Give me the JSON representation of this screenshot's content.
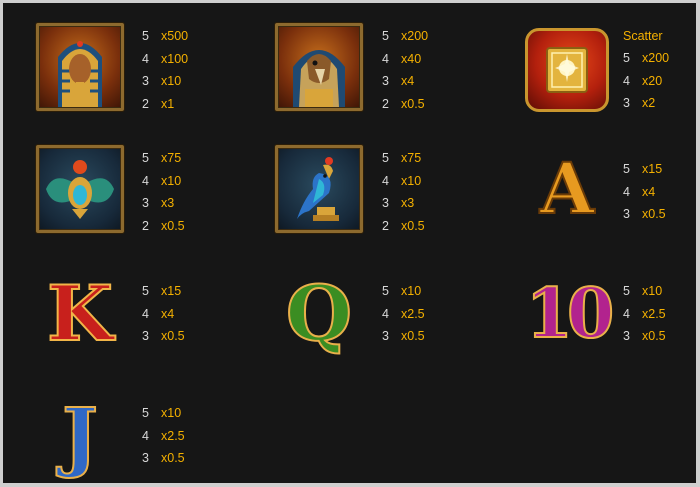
{
  "accent_color": "#f5b100",
  "count_color": "#d8d8d8",
  "symbols": [
    {
      "name": "pharaoh",
      "icon": "pharaoh-icon",
      "caption": "",
      "pays": [
        {
          "count": "5",
          "mult": "x500"
        },
        {
          "count": "4",
          "mult": "x100"
        },
        {
          "count": "3",
          "mult": "x10"
        },
        {
          "count": "2",
          "mult": "x1"
        }
      ]
    },
    {
      "name": "falcon-god",
      "icon": "horus-icon",
      "caption": "",
      "pays": [
        {
          "count": "5",
          "mult": "x200"
        },
        {
          "count": "4",
          "mult": "x40"
        },
        {
          "count": "3",
          "mult": "x4"
        },
        {
          "count": "2",
          "mult": "x0.5"
        }
      ]
    },
    {
      "name": "book",
      "icon": "book-scatter-icon",
      "caption": "Scatter",
      "pays": [
        {
          "count": "5",
          "mult": "x200"
        },
        {
          "count": "4",
          "mult": "x20"
        },
        {
          "count": "3",
          "mult": "x2"
        }
      ]
    },
    {
      "name": "scarab",
      "icon": "scarab-icon",
      "caption": "",
      "pays": [
        {
          "count": "5",
          "mult": "x75"
        },
        {
          "count": "4",
          "mult": "x10"
        },
        {
          "count": "3",
          "mult": "x3"
        },
        {
          "count": "2",
          "mult": "x0.5"
        }
      ]
    },
    {
      "name": "bird",
      "icon": "bird-statue-icon",
      "caption": "",
      "pays": [
        {
          "count": "5",
          "mult": "x75"
        },
        {
          "count": "4",
          "mult": "x10"
        },
        {
          "count": "3",
          "mult": "x3"
        },
        {
          "count": "2",
          "mult": "x0.5"
        }
      ]
    },
    {
      "name": "A",
      "icon": "letter-a-icon",
      "glyph": "A",
      "caption": "",
      "pays": [
        {
          "count": "5",
          "mult": "x15"
        },
        {
          "count": "4",
          "mult": "x4"
        },
        {
          "count": "3",
          "mult": "x0.5"
        }
      ]
    },
    {
      "name": "K",
      "icon": "letter-k-icon",
      "glyph": "K",
      "caption": "",
      "pays": [
        {
          "count": "5",
          "mult": "x15"
        },
        {
          "count": "4",
          "mult": "x4"
        },
        {
          "count": "3",
          "mult": "x0.5"
        }
      ]
    },
    {
      "name": "Q",
      "icon": "letter-q-icon",
      "glyph": "Q",
      "caption": "",
      "pays": [
        {
          "count": "5",
          "mult": "x10"
        },
        {
          "count": "4",
          "mult": "x2.5"
        },
        {
          "count": "3",
          "mult": "x0.5"
        }
      ]
    },
    {
      "name": "10",
      "icon": "number-10-icon",
      "glyph": "10",
      "caption": "",
      "pays": [
        {
          "count": "5",
          "mult": "x10"
        },
        {
          "count": "4",
          "mult": "x2.5"
        },
        {
          "count": "3",
          "mult": "x0.5"
        }
      ]
    },
    {
      "name": "J",
      "icon": "letter-j-icon",
      "glyph": "J",
      "caption": "",
      "pays": [
        {
          "count": "5",
          "mult": "x10"
        },
        {
          "count": "4",
          "mult": "x2.5"
        },
        {
          "count": "3",
          "mult": "x0.5"
        }
      ]
    }
  ]
}
